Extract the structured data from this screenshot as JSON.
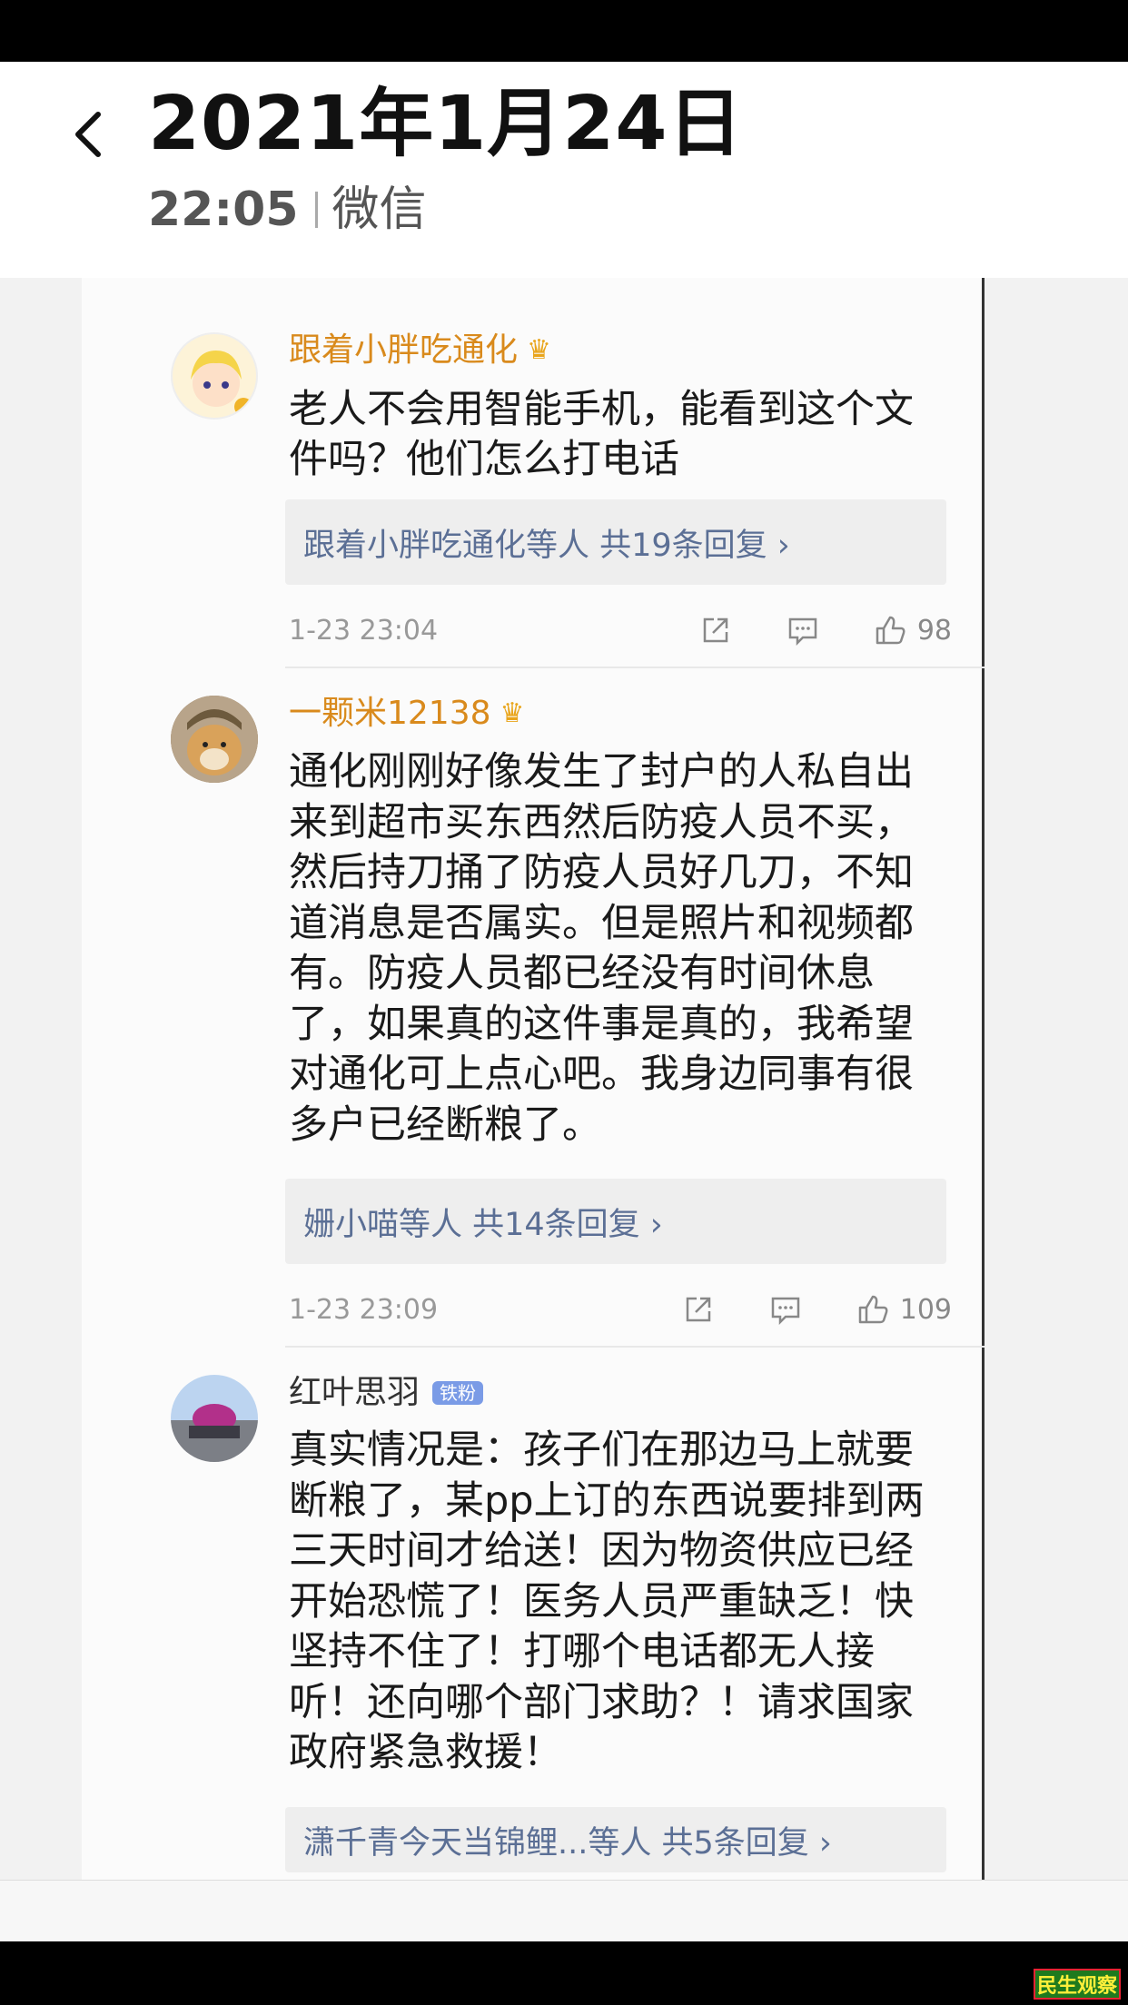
{
  "header": {
    "back_icon": "chevron-left-icon",
    "title": "2021年1月24日",
    "time": "22:05",
    "source": "微信"
  },
  "comments": [
    {
      "username": "跟着小胖吃通化",
      "badge_icon": "crown-icon",
      "text": "老人不会用智能手机，能看到这个文件吗？他们怎么打电话",
      "replies_label": "跟着小胖吃通化等人  共19条回复 ›",
      "date": "1-23 23:04",
      "likes": "98"
    },
    {
      "username": "一颗米12138",
      "badge_icon": "crown-icon",
      "text": "通化刚刚好像发生了封户的人私自出来到超市买东西然后防疫人员不买，然后持刀捅了防疫人员好几刀，不知道消息是否属实。但是照片和视频都有。防疫人员都已经没有时间休息了，如果真的这件事是真的，我希望对通化可上点心吧。我身边同事有很多户已经断粮了。",
      "replies_label": "姗小喵等人  共14条回复 ›",
      "date": "1-23 23:09",
      "likes": "109"
    },
    {
      "username": "红叶思羽",
      "badge_text": "铁粉",
      "text": "真实情况是：孩子们在那边马上就要断粮了，某pp上订的东西说要排到两三天时间才给送！因为物资供应已经开始恐慌了！医务人员严重缺乏！快坚持不住了！打哪个电话都无人接听！还向哪个部门求助？！请求国家政府紧急救援！",
      "replies_label": "潇千青今天当锦鲤...等人  共5条回复 ›"
    }
  ],
  "watermark": "民生观察",
  "colors": {
    "vip_name": "#d98a1c",
    "normal_name": "#333333",
    "reply_link": "#5b6f95"
  }
}
